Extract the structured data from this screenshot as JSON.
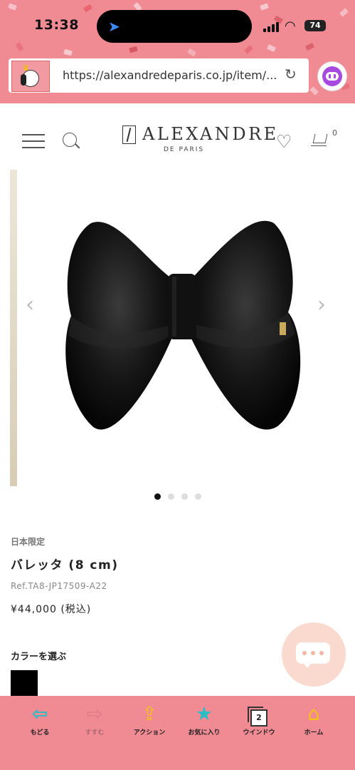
{
  "status_bar": {
    "time": "13:38",
    "battery": "74"
  },
  "browser": {
    "url": "https://alexandredeparis.co.jp/item/..."
  },
  "site": {
    "logo_text": "ALEXANDRE",
    "logo_sub": "DE PARIS",
    "cart_count": "0"
  },
  "gallery": {
    "prev": "‹",
    "next": "›",
    "slide_count": 4,
    "active_slide": 1
  },
  "product": {
    "badge": "日本限定",
    "name": "バレッタ (8 cm)",
    "ref": "Ref.TA8-JP17509-A22",
    "price": "¥44,000 (税込)",
    "color_label": "カラーを選ぶ",
    "selected_color": "#000000"
  },
  "toolbar": {
    "back": "もどる",
    "forward": "すすむ",
    "action": "アクション",
    "favorites": "お気に入り",
    "window": "ウインドウ",
    "window_count": "2",
    "home": "ホーム"
  },
  "colors": {
    "chrome_pink": "#f08a93",
    "accent_teal": "#2bbcc4"
  }
}
